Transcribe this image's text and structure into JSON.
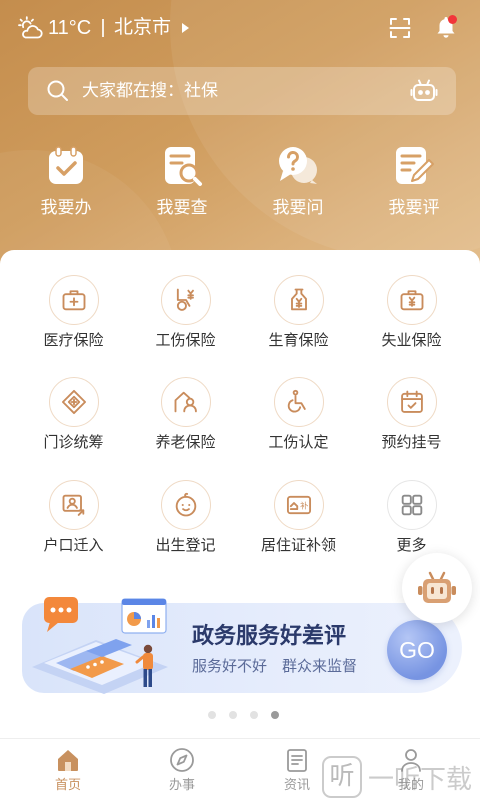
{
  "status_bar": {
    "weather_icon": "cloudy-sun-icon",
    "temperature": "11°C",
    "city": "北京市",
    "city_caret_icon": "caret-right-icon",
    "scan_icon": "scan-icon",
    "notification_icon": "bell-icon",
    "has_unread_notification": true
  },
  "search": {
    "icon": "search-icon",
    "placeholder": "大家都在搜：社保",
    "assistant_icon": "robot-icon"
  },
  "quick_actions": [
    {
      "label": "我要办",
      "icon": "clipboard-check-icon"
    },
    {
      "label": "我要查",
      "icon": "document-search-icon"
    },
    {
      "label": "我要问",
      "icon": "question-bubble-icon"
    },
    {
      "label": "我要评",
      "icon": "document-edit-icon"
    }
  ],
  "services": [
    {
      "label": "医疗保险",
      "icon": "medical-kit-icon"
    },
    {
      "label": "工伤保险",
      "icon": "wheelchair-yuan-icon"
    },
    {
      "label": "生育保险",
      "icon": "bottle-yuan-icon"
    },
    {
      "label": "失业保险",
      "icon": "briefcase-yuan-icon"
    },
    {
      "label": "门诊统筹",
      "icon": "diamond-plus-icon"
    },
    {
      "label": "养老保险",
      "icon": "house-person-icon"
    },
    {
      "label": "工伤认定",
      "icon": "wheelchair-icon"
    },
    {
      "label": "预约挂号",
      "icon": "calendar-check-icon"
    },
    {
      "label": "户口迁入",
      "icon": "id-card-move-in-icon"
    },
    {
      "label": "出生登记",
      "icon": "baby-face-icon"
    },
    {
      "label": "居住证补领",
      "icon": "id-card-reissue-icon",
      "icon_text": "补"
    },
    {
      "label": "更多",
      "icon": "grid-more-icon"
    }
  ],
  "assistant_fab": {
    "icon": "robot-icon"
  },
  "banner": {
    "illustration": "service-rating-illustration",
    "title": "政务服务好差评",
    "subtitle": "服务好不好　群众来监督",
    "button_label": "GO"
  },
  "pagination": {
    "pages": 4,
    "current": 4
  },
  "bottom_nav": [
    {
      "label": "首页",
      "icon": "home-icon",
      "active": true
    },
    {
      "label": "办事",
      "icon": "compass-icon",
      "active": false
    },
    {
      "label": "资讯",
      "icon": "news-icon",
      "active": false
    },
    {
      "label": "我的",
      "icon": "user-icon",
      "active": false
    }
  ],
  "watermark": {
    "logo_text": "听",
    "text": "一听下载"
  },
  "colors": {
    "accent": "#c8915f",
    "header_start": "#c48d4d",
    "header_end": "#e4c08f",
    "service_icon": "#c98c5c",
    "service_ring": "#efdac5",
    "banner_title": "#2b3a6b",
    "banner_subtitle": "#5b6b99",
    "go_button": "#7794e2",
    "notification_dot": "#f2353a",
    "nav_inactive": "#9a9a9a"
  }
}
